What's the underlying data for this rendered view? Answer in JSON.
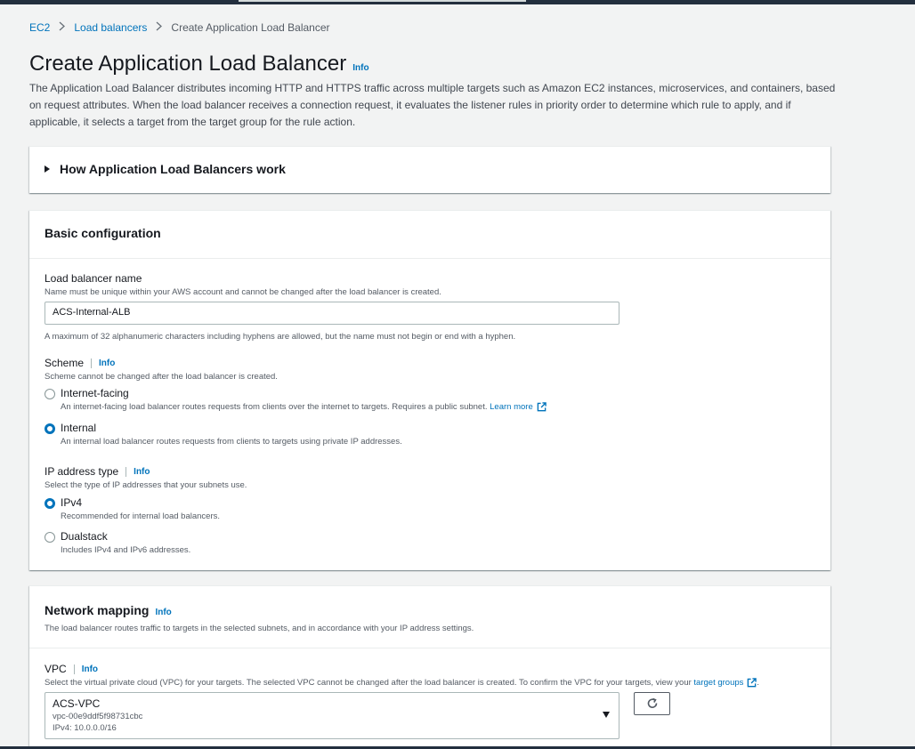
{
  "breadcrumb": {
    "items": [
      "EC2",
      "Load balancers"
    ],
    "current": "Create Application Load Balancer"
  },
  "page": {
    "title": "Create Application Load Balancer",
    "info": "Info",
    "description": "The Application Load Balancer distributes incoming HTTP and HTTPS traffic across multiple targets such as Amazon EC2 instances, microservices, and containers, based on request attributes. When the load balancer receives a connection request, it evaluates the listener rules in priority order to determine which rule to apply, and if applicable, it selects a target from the target group for the rule action."
  },
  "how_it_works": {
    "label": "How Application Load Balancers work"
  },
  "basic": {
    "title": "Basic configuration",
    "name": {
      "label": "Load balancer name",
      "hint": "Name must be unique within your AWS account and cannot be changed after the load balancer is created.",
      "value": "ACS-Internal-ALB",
      "constraint": "A maximum of 32 alphanumeric characters including hyphens are allowed, but the name must not begin or end with a hyphen."
    },
    "scheme": {
      "label": "Scheme",
      "info": "Info",
      "hint": "Scheme cannot be changed after the load balancer is created.",
      "options": [
        {
          "title": "Internet-facing",
          "desc": "An internet-facing load balancer routes requests from clients over the internet to targets. Requires a public subnet.",
          "link": "Learn more",
          "selected": false
        },
        {
          "title": "Internal",
          "desc": "An internal load balancer routes requests from clients to targets using private IP addresses.",
          "selected": true
        }
      ]
    },
    "ip": {
      "label": "IP address type",
      "info": "Info",
      "hint": "Select the type of IP addresses that your subnets use.",
      "options": [
        {
          "title": "IPv4",
          "desc": "Recommended for internal load balancers.",
          "selected": true
        },
        {
          "title": "Dualstack",
          "desc": "Includes IPv4 and IPv6 addresses.",
          "selected": false
        }
      ]
    }
  },
  "network": {
    "title": "Network mapping",
    "info": "Info",
    "description": "The load balancer routes traffic to targets in the selected subnets, and in accordance with your IP address settings.",
    "vpc": {
      "label": "VPC",
      "info": "Info",
      "hint": "Select the virtual private cloud (VPC) for your targets. The selected VPC cannot be changed after the load balancer is created. To confirm the VPC for your targets, view your",
      "hint_link": "target groups",
      "hint_end": ".",
      "selected_name": "ACS-VPC",
      "selected_id": "vpc-00e9ddf5f98731cbc",
      "selected_cidr": "IPv4: 10.0.0.0/16"
    }
  },
  "colors": {
    "link": "#0073bb",
    "radio_selected": "#0073bb",
    "topbar": "#232f3e"
  },
  "icons": {
    "external": "external-link-icon",
    "refresh": "refresh-icon",
    "caret": "caret-right-icon",
    "dropdown": "chevron-down-icon"
  }
}
